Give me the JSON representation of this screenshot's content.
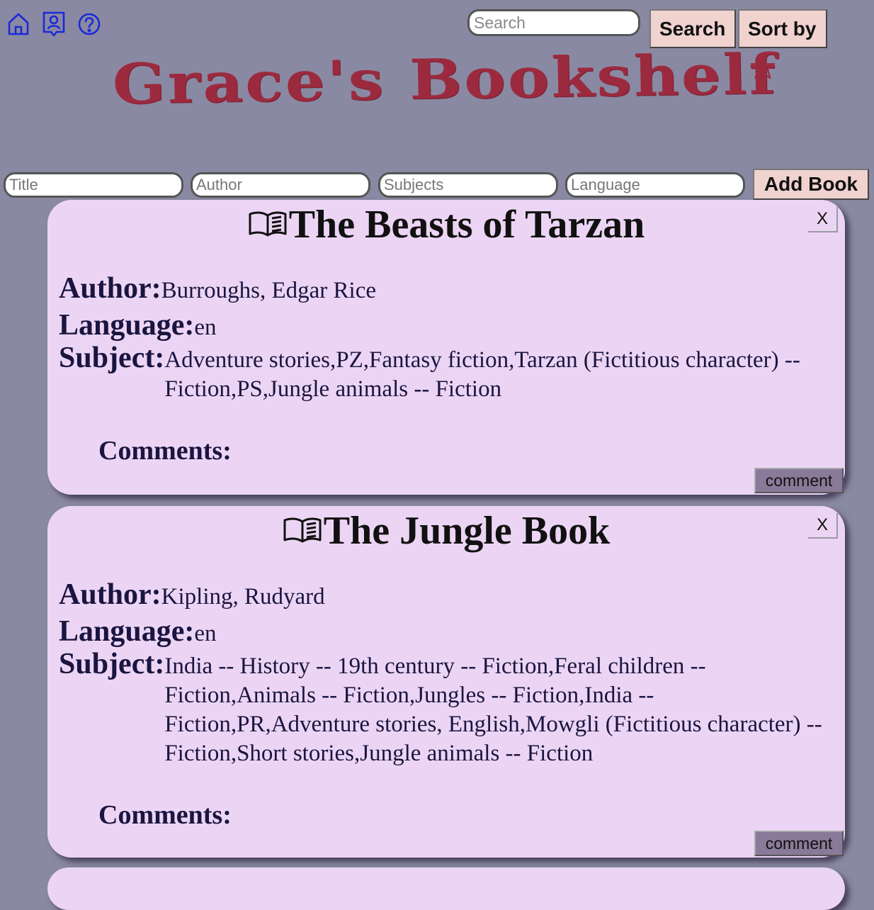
{
  "nav": {
    "icons": [
      "home-icon",
      "profile-icon",
      "help-icon"
    ]
  },
  "search": {
    "placeholder": "Search",
    "value": "",
    "search_label": "Search",
    "sort_label": "Sort by"
  },
  "logo": {
    "text": "Grace's Bookshelf"
  },
  "add_book": {
    "title_placeholder": "Title",
    "author_placeholder": "Author",
    "subjects_placeholder": "Subjects",
    "language_placeholder": "Language",
    "button_label": "Add Book"
  },
  "labels": {
    "author": "Author:",
    "language": "Language:",
    "subject": "Subject:",
    "comments": "Comments:",
    "close": "X",
    "comment_button": "comment"
  },
  "books": [
    {
      "title": "The Beasts of Tarzan",
      "author": "Burroughs, Edgar Rice",
      "language": "en",
      "subject": "Adventure stories,PZ,Fantasy fiction,Tarzan (Fictitious character) -- Fiction,PS,Jungle animals -- Fiction"
    },
    {
      "title": "The Jungle Book",
      "author": "Kipling, Rudyard",
      "language": "en",
      "subject": "India -- History -- 19th century -- Fiction,Feral children -- Fiction,Animals -- Fiction,Jungles -- Fiction,India -- Fiction,PR,Adventure stories, English,Mowgli (Fictitious character) -- Fiction,Short stories,Jungle animals -- Fiction"
    }
  ],
  "colors": {
    "background": "#8a89a3",
    "card": "#ecd5f4",
    "logo": "#9c2a3e",
    "button": "#f0d2cf",
    "comment_button": "#8a7a99",
    "nav_icon": "#1a2ad8"
  }
}
